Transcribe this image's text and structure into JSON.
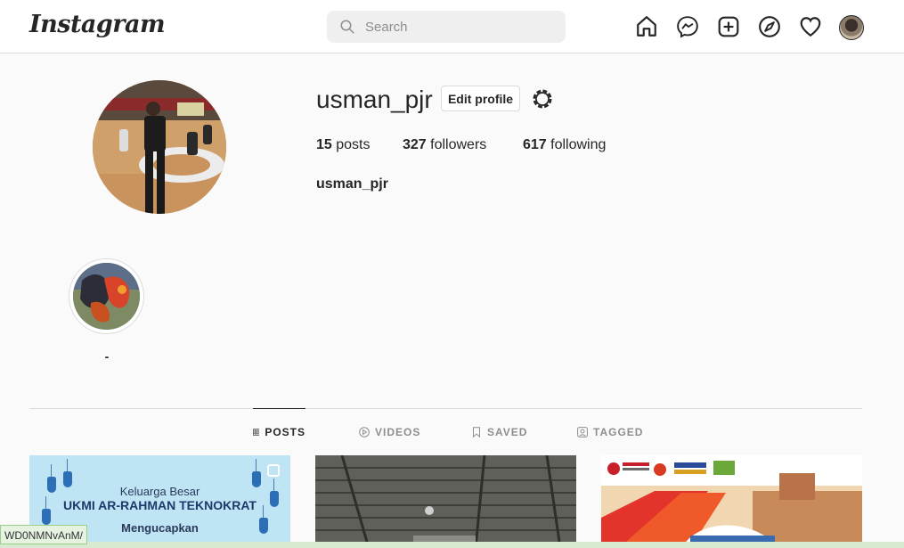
{
  "nav": {
    "logo": "Instagram",
    "search_placeholder": "Search",
    "icons": [
      "home-icon",
      "messenger-icon",
      "new-post-icon",
      "explore-icon",
      "activity-heart-icon",
      "profile-avatar"
    ]
  },
  "profile": {
    "username": "usman_pjr",
    "edit_label": "Edit profile",
    "posts_count": "15",
    "posts_label": " posts",
    "followers_count": "327",
    "followers_label": " followers",
    "following_count": "617",
    "following_label": " following",
    "full_name": "usman_pjr"
  },
  "highlights": [
    {
      "label": "-"
    }
  ],
  "tabs": [
    {
      "label": "POSTS",
      "active": true
    },
    {
      "label": "VIDEOS",
      "active": false
    },
    {
      "label": "SAVED",
      "active": false
    },
    {
      "label": "TAGGED",
      "active": false
    }
  ],
  "posts": [
    {
      "line1": "Keluarga Besar",
      "line2": "UKMI AR-RAHMAN TEKNOKRAT",
      "line3": "Mengucapkan"
    },
    {},
    {}
  ],
  "status_url": "WD0NMNvAnM/",
  "colors": {
    "text": "#262626",
    "muted": "#8e8e8e",
    "border": "#dbdbdb",
    "background": "#fafafa"
  }
}
